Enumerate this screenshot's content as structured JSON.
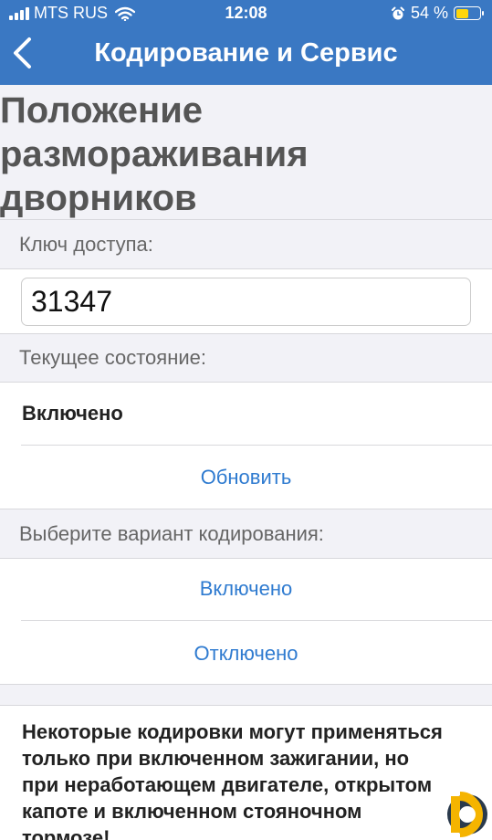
{
  "status_bar": {
    "carrier": "MTS RUS",
    "time": "12:08",
    "battery": "54 %",
    "battery_level": 0.54,
    "icons": [
      "signal-icon",
      "wifi-icon",
      "alarm-icon",
      "battery-icon"
    ]
  },
  "nav": {
    "back_icon": "chevron-left-icon",
    "title": "Кодирование и Сервис"
  },
  "page": {
    "title": "Положение размораживания дворников"
  },
  "access_key": {
    "label": "Ключ доступа:",
    "value": "31347"
  },
  "current_state": {
    "label": "Текущее состояние:",
    "value": "Включено",
    "refresh_label": "Обновить"
  },
  "coding": {
    "label": "Выберите вариант кодирования:",
    "options": [
      "Включено",
      "Отключено"
    ]
  },
  "note": {
    "text": "Некоторые кодировки могут применяться только при включенном зажигании, но при неработающем двигателе, открытом капоте и включенном стояночном тормозе!"
  },
  "colors": {
    "header": "#3a78c3",
    "link": "#2f7bd0",
    "battery": "#ffd60a"
  }
}
